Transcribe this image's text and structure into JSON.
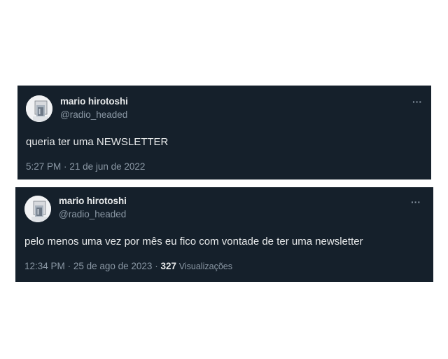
{
  "tweets": [
    {
      "display_name": "mario hirotoshi",
      "handle": "@radio_headed",
      "more": "···",
      "text": "queria ter uma NEWSLETTER",
      "time": "5:27 PM",
      "separator": "·",
      "date": "21 de jun de 2022"
    },
    {
      "display_name": "mario hirotoshi",
      "handle": "@radio_headed",
      "more": "···",
      "text": "pelo menos uma vez por mês eu fico com vontade de ter uma newsletter",
      "time": "12:34 PM",
      "separator": "·",
      "date": "25 de ago de 2023",
      "views_count": "327",
      "views_label": "Visualizações"
    }
  ],
  "colors": {
    "card_background": "#15202b",
    "primary_text": "#e7e9ea",
    "secondary_text": "#8b98a5"
  },
  "icons": {
    "avatar": "profile-photo",
    "more": "more-horizontal-icon"
  }
}
